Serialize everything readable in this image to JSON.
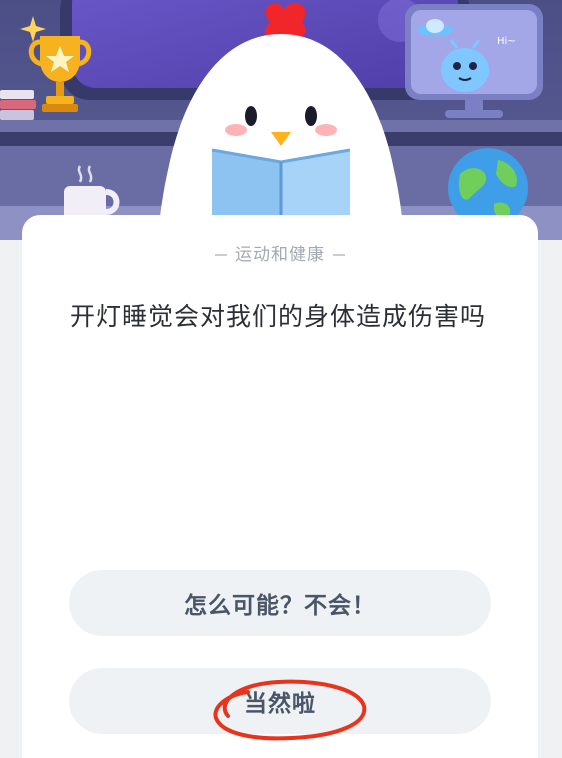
{
  "quiz": {
    "category": "运动和健康",
    "question": "开灯睡觉会对我们的身体造成伤害吗",
    "options": [
      {
        "label": "怎么可能？不会！"
      },
      {
        "label": "当然啦"
      }
    ]
  },
  "illustration": {
    "monitor_text": "Hi~"
  },
  "icons": [
    "trophy-icon",
    "books-icon",
    "mug-icon",
    "globe-icon",
    "alien-monitor-icon",
    "chicken-mascot-icon",
    "sparkle-icon"
  ],
  "colors": {
    "background": "#f0f1f3",
    "card": "#ffffff",
    "option_bg": "#eff2f4",
    "option_text": "#4a5568",
    "question_text": "#2c2f36",
    "category_text": "#a4a9b3",
    "annotation_red": "#e8341c"
  }
}
